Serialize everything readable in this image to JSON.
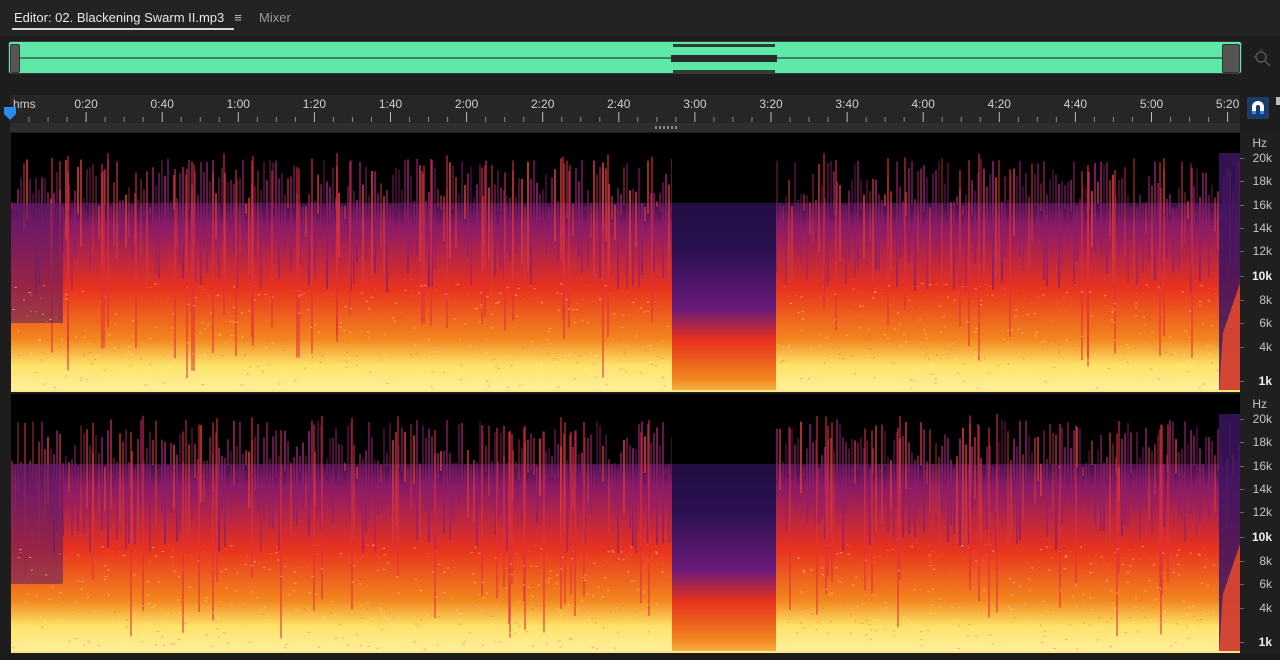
{
  "tabs": {
    "editor_label": "Editor: 02. Blackening Swarm II.mp3",
    "menu_glyph": "≡",
    "mixer_label": "Mixer"
  },
  "timeline": {
    "unit_label": "hms",
    "ticks": [
      "0:20",
      "0:40",
      "1:00",
      "1:20",
      "1:40",
      "2:00",
      "2:20",
      "2:40",
      "3:00",
      "3:20",
      "3:40",
      "4:00",
      "4:20",
      "4:40",
      "5:00",
      "5:20"
    ]
  },
  "frequency_axis": {
    "unit": "Hz",
    "labels": [
      {
        "text": "20k",
        "bold": false
      },
      {
        "text": "18k",
        "bold": false
      },
      {
        "text": "16k",
        "bold": false
      },
      {
        "text": "14k",
        "bold": false
      },
      {
        "text": "12k",
        "bold": false
      },
      {
        "text": "10k",
        "bold": true
      },
      {
        "text": "8k",
        "bold": false
      },
      {
        "text": "6k",
        "bold": false
      },
      {
        "text": "4k",
        "bold": false
      },
      {
        "text": "1k",
        "bold": true
      }
    ]
  },
  "colors": {
    "overview_waveform_bg": "#5ee8a8",
    "spectrogram_low": "#fde36a",
    "spectrogram_mid": "#e8321e",
    "spectrogram_high": "#8a1a66",
    "spectrogram_top": "#3a1248",
    "background": "#000000",
    "snap_button": "#1e3a6a"
  },
  "icons": {
    "zoom": "zoom-to-fit-icon",
    "playhead": "playhead-marker-icon",
    "snap": "snap-magnet-icon"
  }
}
